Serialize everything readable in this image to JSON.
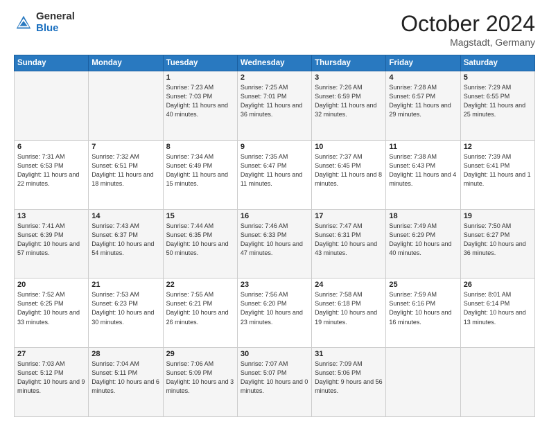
{
  "header": {
    "logo_general": "General",
    "logo_blue": "Blue",
    "month_title": "October 2024",
    "location": "Magstadt, Germany"
  },
  "weekdays": [
    "Sunday",
    "Monday",
    "Tuesday",
    "Wednesday",
    "Thursday",
    "Friday",
    "Saturday"
  ],
  "weeks": [
    [
      {
        "day": "",
        "sunrise": "",
        "sunset": "",
        "daylight": ""
      },
      {
        "day": "",
        "sunrise": "",
        "sunset": "",
        "daylight": ""
      },
      {
        "day": "1",
        "sunrise": "Sunrise: 7:23 AM",
        "sunset": "Sunset: 7:03 PM",
        "daylight": "Daylight: 11 hours and 40 minutes."
      },
      {
        "day": "2",
        "sunrise": "Sunrise: 7:25 AM",
        "sunset": "Sunset: 7:01 PM",
        "daylight": "Daylight: 11 hours and 36 minutes."
      },
      {
        "day": "3",
        "sunrise": "Sunrise: 7:26 AM",
        "sunset": "Sunset: 6:59 PM",
        "daylight": "Daylight: 11 hours and 32 minutes."
      },
      {
        "day": "4",
        "sunrise": "Sunrise: 7:28 AM",
        "sunset": "Sunset: 6:57 PM",
        "daylight": "Daylight: 11 hours and 29 minutes."
      },
      {
        "day": "5",
        "sunrise": "Sunrise: 7:29 AM",
        "sunset": "Sunset: 6:55 PM",
        "daylight": "Daylight: 11 hours and 25 minutes."
      }
    ],
    [
      {
        "day": "6",
        "sunrise": "Sunrise: 7:31 AM",
        "sunset": "Sunset: 6:53 PM",
        "daylight": "Daylight: 11 hours and 22 minutes."
      },
      {
        "day": "7",
        "sunrise": "Sunrise: 7:32 AM",
        "sunset": "Sunset: 6:51 PM",
        "daylight": "Daylight: 11 hours and 18 minutes."
      },
      {
        "day": "8",
        "sunrise": "Sunrise: 7:34 AM",
        "sunset": "Sunset: 6:49 PM",
        "daylight": "Daylight: 11 hours and 15 minutes."
      },
      {
        "day": "9",
        "sunrise": "Sunrise: 7:35 AM",
        "sunset": "Sunset: 6:47 PM",
        "daylight": "Daylight: 11 hours and 11 minutes."
      },
      {
        "day": "10",
        "sunrise": "Sunrise: 7:37 AM",
        "sunset": "Sunset: 6:45 PM",
        "daylight": "Daylight: 11 hours and 8 minutes."
      },
      {
        "day": "11",
        "sunrise": "Sunrise: 7:38 AM",
        "sunset": "Sunset: 6:43 PM",
        "daylight": "Daylight: 11 hours and 4 minutes."
      },
      {
        "day": "12",
        "sunrise": "Sunrise: 7:39 AM",
        "sunset": "Sunset: 6:41 PM",
        "daylight": "Daylight: 11 hours and 1 minute."
      }
    ],
    [
      {
        "day": "13",
        "sunrise": "Sunrise: 7:41 AM",
        "sunset": "Sunset: 6:39 PM",
        "daylight": "Daylight: 10 hours and 57 minutes."
      },
      {
        "day": "14",
        "sunrise": "Sunrise: 7:43 AM",
        "sunset": "Sunset: 6:37 PM",
        "daylight": "Daylight: 10 hours and 54 minutes."
      },
      {
        "day": "15",
        "sunrise": "Sunrise: 7:44 AM",
        "sunset": "Sunset: 6:35 PM",
        "daylight": "Daylight: 10 hours and 50 minutes."
      },
      {
        "day": "16",
        "sunrise": "Sunrise: 7:46 AM",
        "sunset": "Sunset: 6:33 PM",
        "daylight": "Daylight: 10 hours and 47 minutes."
      },
      {
        "day": "17",
        "sunrise": "Sunrise: 7:47 AM",
        "sunset": "Sunset: 6:31 PM",
        "daylight": "Daylight: 10 hours and 43 minutes."
      },
      {
        "day": "18",
        "sunrise": "Sunrise: 7:49 AM",
        "sunset": "Sunset: 6:29 PM",
        "daylight": "Daylight: 10 hours and 40 minutes."
      },
      {
        "day": "19",
        "sunrise": "Sunrise: 7:50 AM",
        "sunset": "Sunset: 6:27 PM",
        "daylight": "Daylight: 10 hours and 36 minutes."
      }
    ],
    [
      {
        "day": "20",
        "sunrise": "Sunrise: 7:52 AM",
        "sunset": "Sunset: 6:25 PM",
        "daylight": "Daylight: 10 hours and 33 minutes."
      },
      {
        "day": "21",
        "sunrise": "Sunrise: 7:53 AM",
        "sunset": "Sunset: 6:23 PM",
        "daylight": "Daylight: 10 hours and 30 minutes."
      },
      {
        "day": "22",
        "sunrise": "Sunrise: 7:55 AM",
        "sunset": "Sunset: 6:21 PM",
        "daylight": "Daylight: 10 hours and 26 minutes."
      },
      {
        "day": "23",
        "sunrise": "Sunrise: 7:56 AM",
        "sunset": "Sunset: 6:20 PM",
        "daylight": "Daylight: 10 hours and 23 minutes."
      },
      {
        "day": "24",
        "sunrise": "Sunrise: 7:58 AM",
        "sunset": "Sunset: 6:18 PM",
        "daylight": "Daylight: 10 hours and 19 minutes."
      },
      {
        "day": "25",
        "sunrise": "Sunrise: 7:59 AM",
        "sunset": "Sunset: 6:16 PM",
        "daylight": "Daylight: 10 hours and 16 minutes."
      },
      {
        "day": "26",
        "sunrise": "Sunrise: 8:01 AM",
        "sunset": "Sunset: 6:14 PM",
        "daylight": "Daylight: 10 hours and 13 minutes."
      }
    ],
    [
      {
        "day": "27",
        "sunrise": "Sunrise: 7:03 AM",
        "sunset": "Sunset: 5:12 PM",
        "daylight": "Daylight: 10 hours and 9 minutes."
      },
      {
        "day": "28",
        "sunrise": "Sunrise: 7:04 AM",
        "sunset": "Sunset: 5:11 PM",
        "daylight": "Daylight: 10 hours and 6 minutes."
      },
      {
        "day": "29",
        "sunrise": "Sunrise: 7:06 AM",
        "sunset": "Sunset: 5:09 PM",
        "daylight": "Daylight: 10 hours and 3 minutes."
      },
      {
        "day": "30",
        "sunrise": "Sunrise: 7:07 AM",
        "sunset": "Sunset: 5:07 PM",
        "daylight": "Daylight: 10 hours and 0 minutes."
      },
      {
        "day": "31",
        "sunrise": "Sunrise: 7:09 AM",
        "sunset": "Sunset: 5:06 PM",
        "daylight": "Daylight: 9 hours and 56 minutes."
      },
      {
        "day": "",
        "sunrise": "",
        "sunset": "",
        "daylight": ""
      },
      {
        "day": "",
        "sunrise": "",
        "sunset": "",
        "daylight": ""
      }
    ]
  ]
}
